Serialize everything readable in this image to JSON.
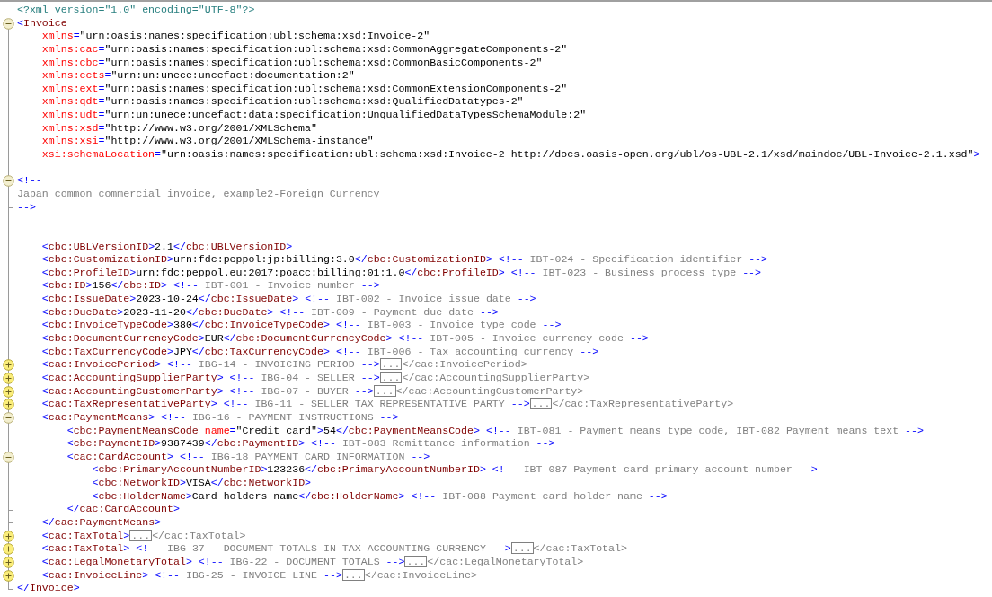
{
  "editor": {
    "lines": [
      {
        "kind": "declaration",
        "code": "<?xml version=\"1.0\" encoding=\"UTF-8\"?>"
      },
      {
        "kind": "code",
        "expanded": true,
        "code": "<Invoice"
      },
      {
        "kind": "code",
        "code": "    xmlns=\"urn:oasis:names:specification:ubl:schema:xsd:Invoice-2\""
      },
      {
        "kind": "code",
        "code": "    xmlns:cac=\"urn:oasis:names:specification:ubl:schema:xsd:CommonAggregateComponents-2\""
      },
      {
        "kind": "code",
        "code": "    xmlns:cbc=\"urn:oasis:names:specification:ubl:schema:xsd:CommonBasicComponents-2\""
      },
      {
        "kind": "code",
        "code": "    xmlns:ccts=\"urn:un:unece:uncefact:documentation:2\""
      },
      {
        "kind": "code",
        "code": "    xmlns:ext=\"urn:oasis:names:specification:ubl:schema:xsd:CommonExtensionComponents-2\""
      },
      {
        "kind": "code",
        "code": "    xmlns:qdt=\"urn:oasis:names:specification:ubl:schema:xsd:QualifiedDatatypes-2\""
      },
      {
        "kind": "code",
        "code": "    xmlns:udt=\"urn:un:unece:uncefact:data:specification:UnqualifiedDataTypesSchemaModule:2\""
      },
      {
        "kind": "code",
        "code": "    xmlns:xsd=\"http://www.w3.org/2001/XMLSchema\""
      },
      {
        "kind": "code",
        "code": "    xmlns:xsi=\"http://www.w3.org/2001/XMLSchema-instance\""
      },
      {
        "kind": "code",
        "code": "    xsi:schemaLocation=\"urn:oasis:names:specification:ubl:schema:xsd:Invoice-2 http://docs.oasis-open.org/ubl/os-UBL-2.1/xsd/maindoc/UBL-Invoice-2.1.xsd\">"
      },
      {
        "kind": "blank"
      },
      {
        "kind": "comment",
        "expanded": true,
        "comment": "<!--"
      },
      {
        "kind": "comment",
        "comment": "Japan common commercial invoice, example2-Foreign Currency"
      },
      {
        "kind": "comment",
        "block_end": true,
        "comment": "-->"
      },
      {
        "kind": "blank"
      },
      {
        "kind": "blank"
      },
      {
        "kind": "code",
        "code": "    <cbc:UBLVersionID>2.1</cbc:UBLVersionID>"
      },
      {
        "kind": "code",
        "code": "    <cbc:CustomizationID>urn:fdc:peppol:jp:billing:3.0</cbc:CustomizationID>",
        "comment": "<!-- IBT-024 - Specification identifier -->"
      },
      {
        "kind": "code",
        "code": "    <cbc:ProfileID>urn:fdc:peppol.eu:2017:poacc:billing:01:1.0</cbc:ProfileID>",
        "comment": "<!-- IBT-023 - Business process type -->"
      },
      {
        "kind": "code",
        "code": "    <cbc:ID>156</cbc:ID>",
        "comment": "<!-- IBT-001 - Invoice number -->"
      },
      {
        "kind": "code",
        "code": "    <cbc:IssueDate>2023-10-24</cbc:IssueDate>",
        "comment": "<!-- IBT-002 - Invoice issue date -->"
      },
      {
        "kind": "code",
        "code": "    <cbc:DueDate>2023-11-20</cbc:DueDate>",
        "comment": "<!-- IBT-009 - Payment due date -->"
      },
      {
        "kind": "code",
        "code": "    <cbc:InvoiceTypeCode>380</cbc:InvoiceTypeCode>",
        "comment": "<!-- IBT-003 - Invoice type code -->"
      },
      {
        "kind": "code",
        "code": "    <cbc:DocumentCurrencyCode>EUR</cbc:DocumentCurrencyCode>",
        "comment": "<!-- IBT-005 - Invoice currency code -->"
      },
      {
        "kind": "code",
        "code": "    <cbc:TaxCurrencyCode>JPY</cbc:TaxCurrencyCode>",
        "comment": "<!-- IBT-006 - Tax accounting currency -->"
      },
      {
        "kind": "code",
        "expanded": false,
        "code": "    <cac:InvoicePeriod>",
        "comment": "<!-- IBG-14 - INVOICING PERIOD -->",
        "placeholder": "...",
        "tail": "</cac:InvoicePeriod>"
      },
      {
        "kind": "code",
        "expanded": false,
        "code": "    <cac:AccountingSupplierParty>",
        "comment": "<!-- IBG-04 - SELLER -->",
        "placeholder": "...",
        "tail": "</cac:AccountingSupplierParty>"
      },
      {
        "kind": "code",
        "expanded": false,
        "code": "    <cac:AccountingCustomerParty>",
        "comment": "<!-- IBG-07 - BUYER -->",
        "placeholder": "...",
        "tail": "</cac:AccountingCustomerParty>"
      },
      {
        "kind": "code",
        "expanded": false,
        "code": "    <cac:TaxRepresentativeParty>",
        "comment": "<!-- IBG-11 - SELLER TAX REPRESENTATIVE PARTY -->",
        "placeholder": "...",
        "tail": "</cac:TaxRepresentativeParty>"
      },
      {
        "kind": "code",
        "expanded": true,
        "code": "    <cac:PaymentMeans>",
        "comment": "<!-- IBG-16 - PAYMENT INSTRUCTIONS -->"
      },
      {
        "kind": "code",
        "code": "        <cbc:PaymentMeansCode name=\"Credit card\">54</cbc:PaymentMeansCode>",
        "comment": "<!-- IBT-081 - Payment means type code, IBT-082 Payment means text -->"
      },
      {
        "kind": "code",
        "code": "        <cbc:PaymentID>9387439</cbc:PaymentID>",
        "comment": "<!-- IBT-083 Remittance information -->"
      },
      {
        "kind": "code",
        "expanded": true,
        "code": "        <cac:CardAccount>",
        "comment": "<!-- IBG-18 PAYMENT CARD INFORMATION -->"
      },
      {
        "kind": "code",
        "code": "            <cbc:PrimaryAccountNumberID>123236</cbc:PrimaryAccountNumberID>",
        "comment": "<!-- IBT-087 Payment card primary account number -->"
      },
      {
        "kind": "code",
        "code": "            <cbc:NetworkID>VISA</cbc:NetworkID>"
      },
      {
        "kind": "code",
        "code": "            <cbc:HolderName>Card holders name</cbc:HolderName>",
        "comment": "<!-- IBT-088 Payment card holder name -->"
      },
      {
        "kind": "code",
        "block_end": true,
        "code": "        </cac:CardAccount>"
      },
      {
        "kind": "code",
        "block_end": true,
        "code": "    </cac:PaymentMeans>"
      },
      {
        "kind": "code",
        "expanded": false,
        "code": "    <cac:TaxTotal>",
        "placeholder": "...",
        "tail": "</cac:TaxTotal>"
      },
      {
        "kind": "code",
        "expanded": false,
        "code": "    <cac:TaxTotal>",
        "comment": "<!-- IBG-37 - DOCUMENT TOTALS IN TAX ACCOUNTING CURRENCY -->",
        "placeholder": "...",
        "tail": "</cac:TaxTotal>"
      },
      {
        "kind": "code",
        "expanded": false,
        "code": "    <cac:LegalMonetaryTotal>",
        "comment": "<!-- IBG-22 - DOCUMENT TOTALS -->",
        "placeholder": "...",
        "tail": "</cac:LegalMonetaryTotal>"
      },
      {
        "kind": "code",
        "expanded": false,
        "code": "    <cac:InvoiceLine>",
        "comment": "<!-- IBG-25 - INVOICE LINE -->",
        "placeholder": "...",
        "tail": "</cac:InvoiceLine>"
      },
      {
        "kind": "code",
        "block_end": true,
        "code": "</Invoice>"
      }
    ]
  }
}
